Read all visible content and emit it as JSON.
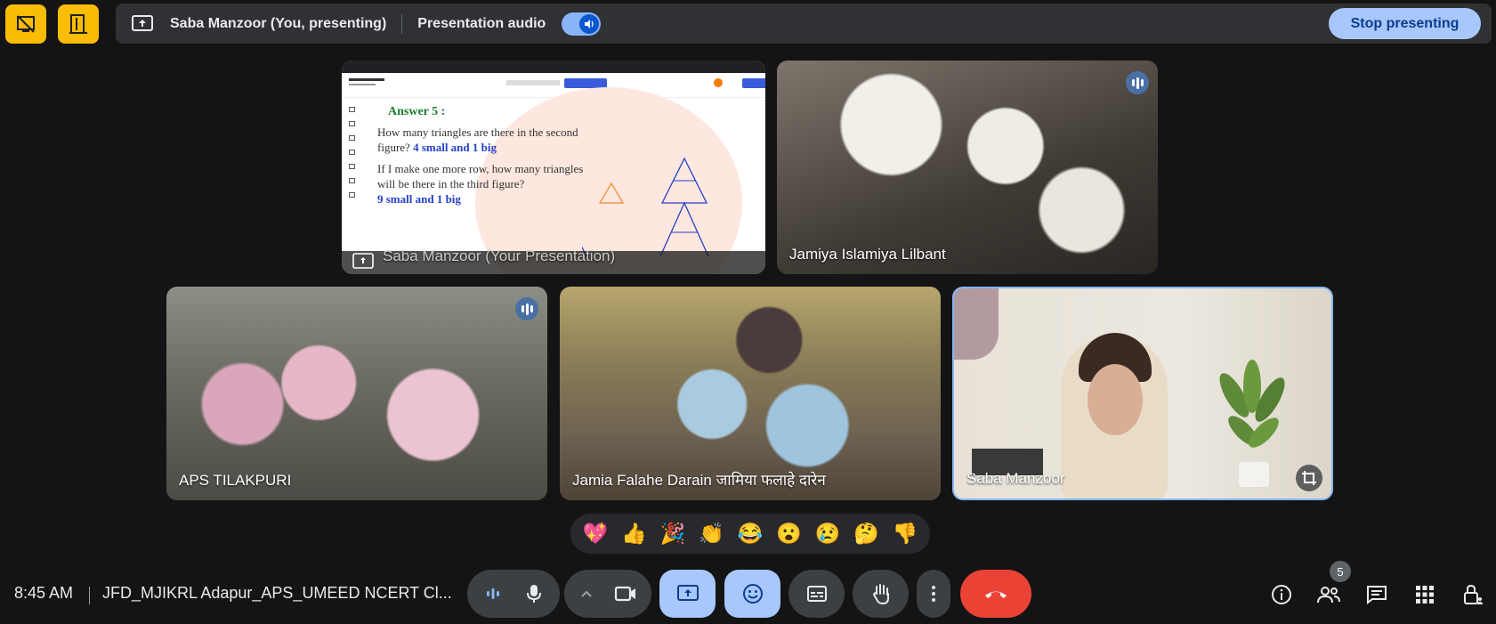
{
  "top": {
    "presenter": "Saba Manzoor (You, presenting)",
    "audio_label": "Presentation audio",
    "stop_label": "Stop presenting"
  },
  "slide": {
    "answer_title": "Answer 5 :",
    "q1": "How many triangles are there in the second figure?",
    "a1": "4 small and 1 big",
    "q2": "If I make one more row, how many triangles will be there in the third figure?",
    "a2": "9 small and 1 big"
  },
  "tiles": [
    {
      "name": "Saba Manzoor (Your Presentation)"
    },
    {
      "name": "Jamiya Islamiya Lilbant"
    },
    {
      "name": "APS TILAKPURI"
    },
    {
      "name": "Jamia Falahe Darain जामिया फलाहे दारेन"
    },
    {
      "name": "Saba Manzoor"
    }
  ],
  "reactions": [
    "💖",
    "👍",
    "🎉",
    "👏",
    "😂",
    "😮",
    "😢",
    "🤔",
    "👎"
  ],
  "bottom": {
    "time": "8:45 AM",
    "meeting_name": "JFD_MJIKRL Adapur_APS_UMEED NCERT Cl...",
    "participants_count": "5"
  },
  "colors": {
    "accent": "#8ab4f8",
    "warning": "#fbbc04",
    "end_call": "#ea4335"
  }
}
